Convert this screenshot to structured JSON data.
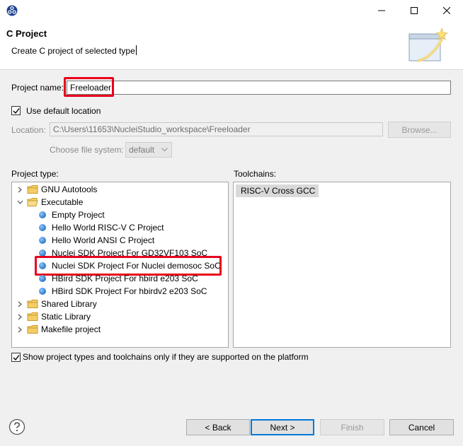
{
  "window": {
    "minimize_icon": "minimize-icon",
    "maximize_icon": "maximize-icon",
    "close_icon": "close-icon"
  },
  "header": {
    "title": "C Project",
    "description": "Create C project of selected type"
  },
  "project_name": {
    "label": "Project name:",
    "value": "Freeloader"
  },
  "use_default_location": {
    "label": "Use default location",
    "checked": true
  },
  "location": {
    "label": "Location:",
    "value": "C:\\Users\\11653\\NucleiStudio_workspace\\Freeloader",
    "browse_label": "Browse..."
  },
  "file_system": {
    "label": "Choose file system:",
    "value": "default"
  },
  "project_type": {
    "label": "Project type:",
    "items": [
      {
        "label": "GNU Autotools",
        "kind": "folder",
        "expanded": false,
        "depth": 0
      },
      {
        "label": "Executable",
        "kind": "folder",
        "expanded": true,
        "depth": 0
      },
      {
        "label": "Empty Project",
        "kind": "leaf",
        "depth": 1
      },
      {
        "label": "Hello World RISC-V C Project",
        "kind": "leaf",
        "depth": 1
      },
      {
        "label": "Hello World ANSI C Project",
        "kind": "leaf",
        "depth": 1
      },
      {
        "label": "Nuclei SDK Project For GD32VF103 SoC",
        "kind": "leaf",
        "depth": 1
      },
      {
        "label": "Nuclei SDK Project For Nuclei demosoc SoC",
        "kind": "leaf",
        "depth": 1,
        "highlighted": true
      },
      {
        "label": "HBird SDK Project For hbird e203 SoC",
        "kind": "leaf",
        "depth": 1
      },
      {
        "label": "HBird SDK Project For hbirdv2 e203 SoC",
        "kind": "leaf",
        "depth": 1
      },
      {
        "label": "Shared Library",
        "kind": "folder",
        "expanded": false,
        "depth": 0
      },
      {
        "label": "Static Library",
        "kind": "folder",
        "expanded": false,
        "depth": 0
      },
      {
        "label": "Makefile project",
        "kind": "folder",
        "expanded": false,
        "depth": 0
      }
    ]
  },
  "toolchains": {
    "label": "Toolchains:",
    "items": [
      "RISC-V Cross GCC"
    ]
  },
  "show_supported": {
    "label": "Show project types and toolchains only if they are supported on the platform",
    "checked": true
  },
  "buttons": {
    "back": "< Back",
    "next": "Next >",
    "finish": "Finish",
    "cancel": "Cancel"
  },
  "colors": {
    "highlight": "#e8001c",
    "accent": "#0078d7"
  }
}
